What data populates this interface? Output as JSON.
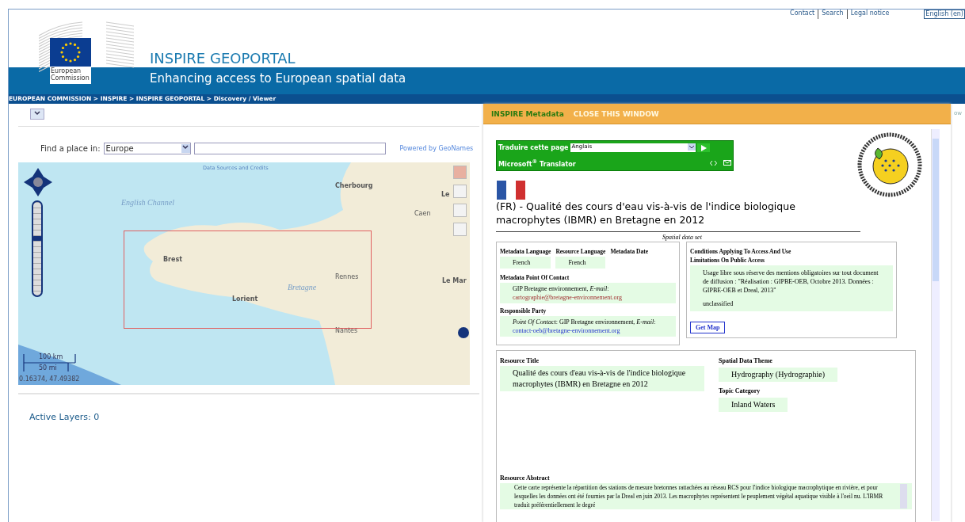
{
  "header": {
    "links": [
      "Contact",
      "Search",
      "Legal notice"
    ],
    "language": "English (en)",
    "logo_text": "European Commission",
    "title": "INSPIRE GEOPORTAL",
    "tagline": "Enhancing access to European spatial data",
    "breadcrumb": "EUROPEAN COMMISSION > INSPIRE > INSPIRE GEOPORTAL > Discovery / Viewer"
  },
  "viewer": {
    "place_label": "Find a place in:",
    "region": "Europe",
    "powered_by": "Powered by GeoNames",
    "map": {
      "credits": "Data Sources and Credits",
      "labels": [
        "Cherbourg",
        "Le",
        "English Channel",
        "Caen",
        "Brest",
        "Rennes",
        "Le Mar",
        "Bretagne",
        "Lorient",
        "Nantes"
      ],
      "zoom_slider": {
        "level": 0.61
      },
      "scale": [
        "100 km",
        "50 mi"
      ],
      "coordinates": "0.16374, 47.49382"
    },
    "active_layers": "Active Layers: 0"
  },
  "metadata_window": {
    "title": "INSPIRE Metadata",
    "close": "CLOSE THIS WINDOW",
    "behind_text": "ow",
    "translator": {
      "label": "Traduire cette page",
      "language": "Anglais",
      "brand": "Microsoft$^{®}$ Translator"
    },
    "record_title": "(FR) - Qualité des cours d'eau vis-à-vis de l'indice biologique macrophytes (IBMR) en Bretagne en 2012",
    "resource_type": "Spatial data set",
    "left_box": {
      "languages": [
        {
          "label": "Metadata Language",
          "value": "French"
        },
        {
          "label": "Resource Language",
          "value": "French"
        },
        {
          "label": "Metadata Date"
        }
      ],
      "point_of_contact": {
        "label": "Metadata Point Of Contact",
        "org": "GIP Bretagne environnement, *E-mail*:",
        "email": "cartographie@bretagne-environnement.org"
      },
      "responsible_party": {
        "label": "Responsible Party",
        "org": "*Point Of Contact*: GIP Bretagne environnement, *E-mail*:",
        "email": "contact-oeb@bretagne-environnement.org"
      }
    },
    "right_box": {
      "conditions": "Conditions Applying To Access And Use",
      "limitations_label": "Limitations On Public Access",
      "limitations": "Usage libre sous réserve des mentions obligatoires sur tout document de diffusion : \"Réalisation : GIPBE-OEB, Octobre 2013. Données : GIPBE-OEB et Dreal, 2013\"",
      "classification": "unclassified",
      "get_map": "Get Map"
    },
    "resource_title_label": "Resource Title",
    "resource_title": "Qualité des cours d'eau vis-à-vis de l'indice biologique macrophytes (IBMR) en Bretagne en 2012",
    "theme_label": "Spatial Data Theme",
    "theme": "Hydrography (Hydrographie)",
    "topic_label": "Topic Category",
    "topic": "Inland Waters",
    "abstract_label": "Resource Abstract",
    "abstract": "Cette carte représente la répartition des stations de mesure bretonnes rattachées au réseau RCS pour l'indice biologique macrophytique en rivière, et pour lesquelles les données ont été fournies par la Dreal en juin 2013. Les macrophytes représentent le peuplement végétal aquatique visible à l'oeil nu. L'IBMR traduit préférentiellement le degré"
  }
}
